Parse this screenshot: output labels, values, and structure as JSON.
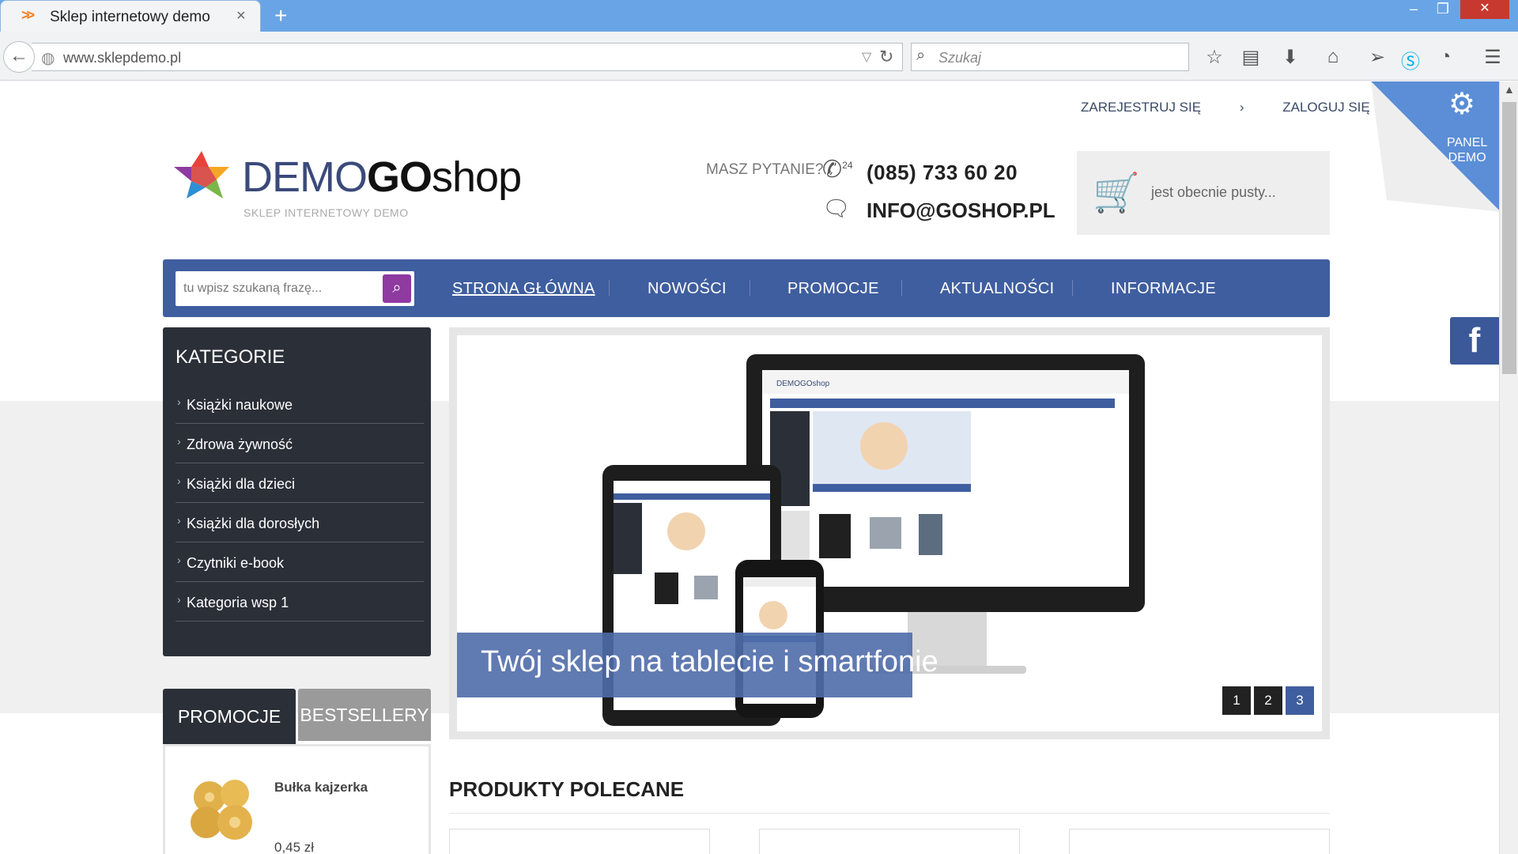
{
  "browser": {
    "tab_title": "Sklep internetowy demo",
    "tab_close": "×",
    "new_tab": "+",
    "window_controls": {
      "minimize": "–",
      "maximize": "❐",
      "close": "✕"
    },
    "url": "www.sklepdemo.pl",
    "search_placeholder": "Szukaj",
    "toolbar_icons": [
      "bookmark-star-icon",
      "reading-list-icon",
      "download-icon",
      "home-icon",
      "send-icon",
      "skype-icon",
      "extension-icon",
      "menu-icon"
    ]
  },
  "header": {
    "top_links": {
      "register": "ZAREJESTRUJ SIĘ",
      "login": "ZALOGUJ SIĘ"
    },
    "logo": {
      "part1": "DEMO",
      "part2": "GO",
      "part3": "shop",
      "subtitle": "SKLEP INTERNETOWY DEMO"
    },
    "contact": {
      "question": "MASZ PYTANIE?",
      "phone_badge": "24",
      "phone": "(085) 733 60 20",
      "email": "INFO@GOSHOP.PL"
    },
    "cart": {
      "status": "jest obecnie pusty..."
    }
  },
  "nav": {
    "search_placeholder": "tu wpisz szukaną frazę...",
    "items": [
      "STRONA GŁÓWNA",
      "NOWOŚCI",
      "PROMOCJE",
      "AKTUALNOŚCI",
      "INFORMACJE"
    ]
  },
  "sidebar": {
    "title": "KATEGORIE",
    "categories": [
      "Książki naukowe",
      "Zdrowa żywność",
      "Książki dla dzieci",
      "Książki dla dorosłych",
      "Czytniki e-book",
      "Kategoria wsp 1"
    ]
  },
  "slider": {
    "caption": "Twój sklep na tablecie i smartfonie",
    "pages": [
      "1",
      "2",
      "3"
    ],
    "active_page": "3",
    "monitor_logo": "DEMOGOshop"
  },
  "promo_tabs": {
    "tab1": "PROMOCJE",
    "tab2": "BESTSELLERY",
    "product": {
      "name": "Bułka kajzerka",
      "price": "0,45 zł"
    }
  },
  "featured": {
    "title": "PRODUKTY POLECANE"
  },
  "panel_demo": {
    "line1": "PANEL",
    "line2": "DEMO"
  },
  "social": {
    "facebook": "f"
  },
  "colors": {
    "nav_blue": "#3f5e9f",
    "dark_panel": "#2b2f38",
    "search_button": "#8e3aa0",
    "titlebar": "#69a5e6"
  }
}
